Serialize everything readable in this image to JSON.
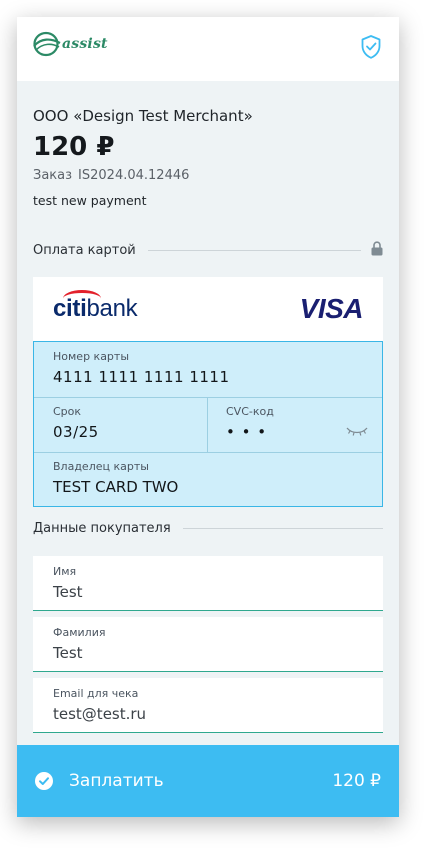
{
  "header": {
    "logo_text": "assist"
  },
  "merchant": {
    "name": "ООО «Design Test Merchant»",
    "amount": "120 ₽",
    "order_label": "Заказ",
    "order_number": "IS2024.04.12446",
    "description": "test new payment"
  },
  "payment_section": {
    "title": "Оплата картой"
  },
  "card": {
    "bank": {
      "prefix": "citi",
      "suffix": "bank"
    },
    "network": "VISA",
    "number_label": "Номер карты",
    "number_value": "4111  1111  1111  1111",
    "expiry_label": "Срок",
    "expiry_value": "03/25",
    "cvc_label": "CVC-код",
    "cvc_value": "• • •",
    "holder_label": "Владелец карты",
    "holder_value": "TEST CARD TWO"
  },
  "buyer_section": {
    "title": "Данные покупателя"
  },
  "buyer": {
    "first_name_label": "Имя",
    "first_name_value": "Test",
    "last_name_label": "Фамилия",
    "last_name_value": "Test",
    "email_label": "Email для чека",
    "email_value": "test@test.ru"
  },
  "pay": {
    "label": "Заплатить",
    "amount": "120 ₽"
  },
  "colors": {
    "accent": "#3dbcf2",
    "card_bg": "#cfeefa",
    "brand_green": "#2c8a66"
  },
  "icons": [
    "assist-logo",
    "shield-check-icon",
    "lock-icon",
    "eye-closed-icon",
    "check-circle-icon"
  ]
}
